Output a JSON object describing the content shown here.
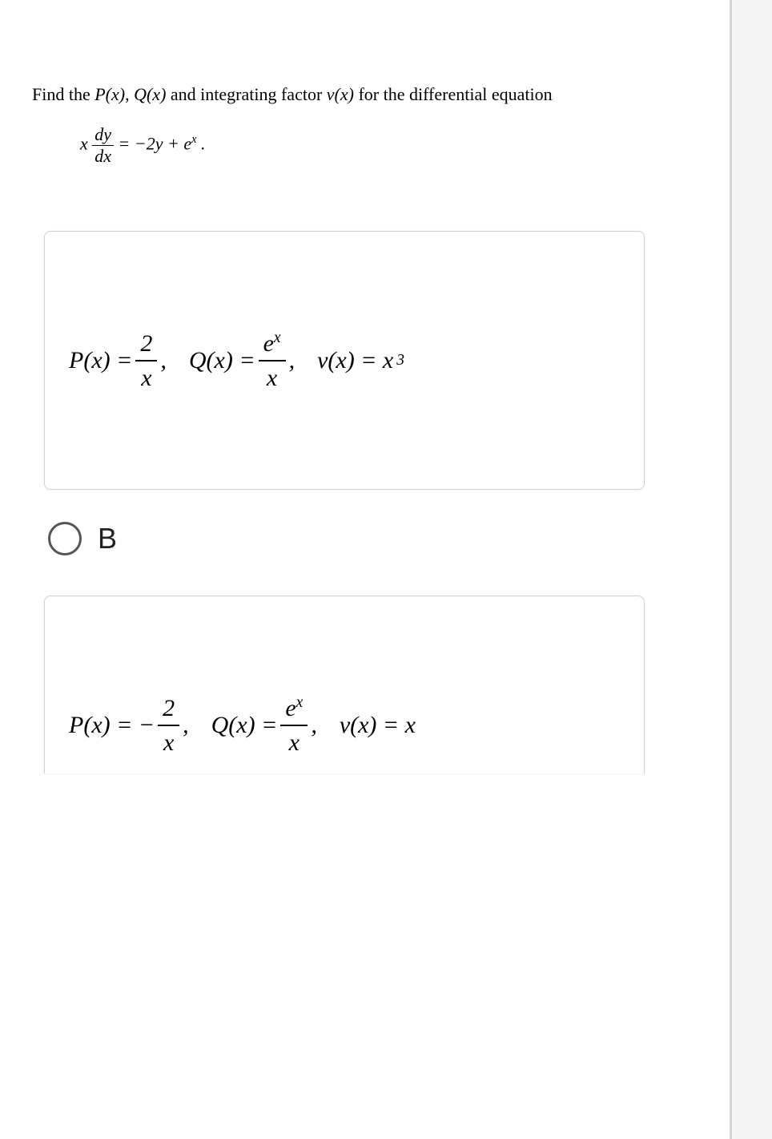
{
  "question": {
    "prompt_prefix": "Find the ",
    "pqv": {
      "p": "P(x)",
      "q": "Q(x)",
      "v": "v(x)"
    },
    "prompt_middle1": " and integrating factor ",
    "prompt_middle2": " for the differential equation",
    "equation": {
      "lhs_x": "x",
      "dy": "dy",
      "dx": "dx",
      "rhs": "= −2y + e",
      "sup": "x",
      "period": " ."
    }
  },
  "answer_a": {
    "p_lhs": "P(x) =",
    "p_num": "2",
    "p_den": "x",
    "q_lhs": "Q(x) =",
    "q_num_e": "e",
    "q_num_sup": "x",
    "q_den": "x",
    "v_lhs": "v(x) = x",
    "v_sup": "3"
  },
  "option_b": {
    "label": "B"
  },
  "answer_b": {
    "p_lhs": "P(x) = −",
    "p_num": "2",
    "p_den": "x",
    "q_lhs": "Q(x) =",
    "q_num_e": "e",
    "q_num_sup": "x",
    "q_den": "x",
    "v_lhs": "v(x) = x"
  }
}
